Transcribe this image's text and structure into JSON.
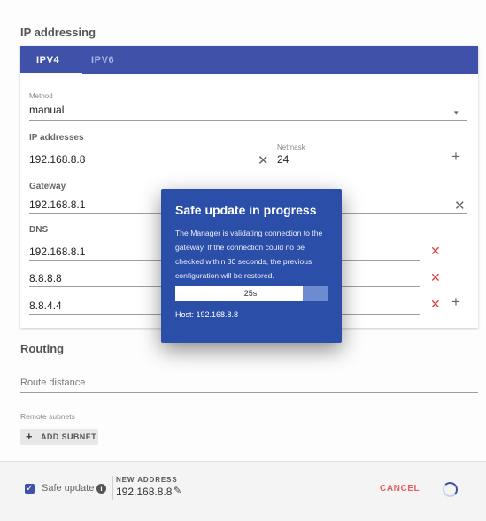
{
  "ip_section": {
    "title": "IP addressing",
    "tabs": [
      {
        "label": "IPV4",
        "active": true
      },
      {
        "label": "IPV6",
        "active": false
      }
    ]
  },
  "form": {
    "method": {
      "label": "Method",
      "value": "manual"
    },
    "ip_addresses": {
      "label": "IP addresses",
      "address": "192.168.8.8",
      "netmask_label": "Netmask",
      "netmask": "24"
    },
    "gateway": {
      "label": "Gateway",
      "value": "192.168.8.1"
    },
    "dns": {
      "label": "DNS",
      "servers": [
        "192.168.8.1",
        "8.8.8.8",
        "8.8.4.4"
      ]
    }
  },
  "dialog": {
    "title": "Safe update in progress",
    "body": "The Manager is validating connection to the gateway. If the connection could no be checked within 30 seconds, the previous configuration will be restored.",
    "countdown": "25s",
    "progress_fraction": 0.84,
    "host": "Host: 192.168.8.8"
  },
  "routing": {
    "title": "Routing",
    "route_distance_placeholder": "Route distance",
    "remote_subnets_label": "Remote subnets",
    "add_subnet_label": "ADD SUBNET"
  },
  "footer": {
    "safe_update_label": "Safe update",
    "safe_update_checked": true,
    "new_address_label": "NEW ADDRESS",
    "new_address_value": "192.168.8.8",
    "cancel_label": "CANCEL"
  },
  "colors": {
    "primary": "#3f51a8",
    "dialog": "#2b4fa9",
    "danger": "#e53935",
    "cancel": "#e06060"
  },
  "icons": {
    "dropdown": "chevron-down-icon",
    "clear": "close-icon",
    "remove": "close-icon",
    "add": "plus-icon",
    "info": "info-icon",
    "edit": "pencil-icon",
    "loading": "spinner-icon"
  }
}
